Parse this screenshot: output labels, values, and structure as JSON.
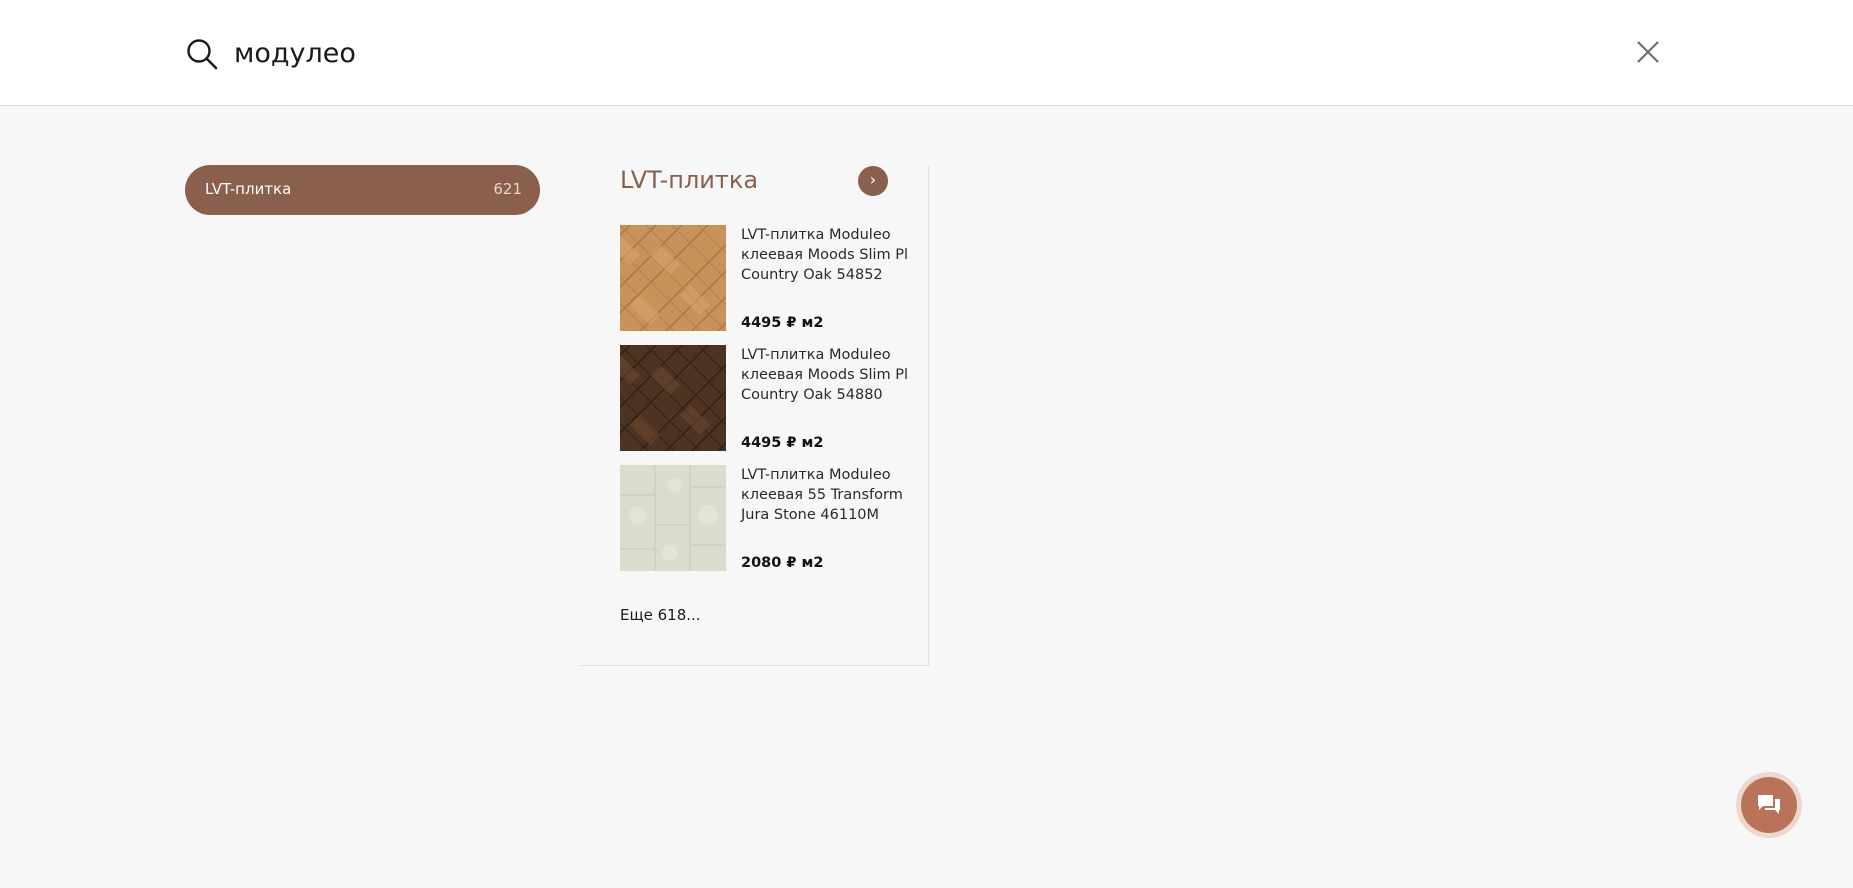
{
  "search": {
    "value": "модулео",
    "placeholder": ""
  },
  "categories": [
    {
      "label": "LVT-плитка",
      "count": "621"
    }
  ],
  "results": {
    "title": "LVT-плитка",
    "arrow": "›",
    "products": [
      {
        "name": "LVT-плитка Moduleo клеевая Moods Slim Pl Country Oak 54852",
        "price": "4495 ₽ м2"
      },
      {
        "name": "LVT-плитка Moduleo клеевая Moods Slim Pl Country Oak 54880",
        "price": "4495 ₽ м2"
      },
      {
        "name": "LVT-плитка Moduleo клеевая 55 Transform Jura Stone 46110M",
        "price": "2080 ₽ м2"
      }
    ],
    "more": "Еще 618..."
  },
  "colors": {
    "accent": "#8a5f4d",
    "chat_button": "#b8735a"
  },
  "icons": {
    "search": "search-icon",
    "close": "close-icon",
    "chat": "chat-bubbles-icon"
  }
}
